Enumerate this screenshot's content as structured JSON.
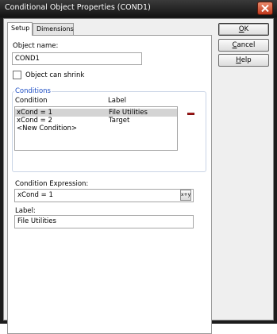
{
  "window": {
    "title": "Conditional Object Properties (COND1)"
  },
  "tabs": [
    {
      "label": "Setup",
      "active": true
    },
    {
      "label": "Dimensions",
      "active": false
    }
  ],
  "setup": {
    "object_name_label": "Object name:",
    "object_name_value": "COND1",
    "can_shrink_label": "Object can shrink",
    "can_shrink_checked": false,
    "conditions_caption": "Conditions",
    "col_condition": "Condition",
    "col_label": "Label",
    "conditions": [
      {
        "condition": "xCond = 1",
        "label": "File Utilities",
        "selected": true
      },
      {
        "condition": "xCond = 2",
        "label": "Target",
        "selected": false
      },
      {
        "condition": "<New Condition>",
        "label": "",
        "selected": false
      }
    ],
    "expression_label": "Condition Expression:",
    "expression_value": "xCond = 1",
    "expression_button": "x+y",
    "label_label": "Label:",
    "label_value": "File Utilities"
  },
  "buttons": {
    "ok_accel": "O",
    "ok_rest": "K",
    "cancel_accel": "C",
    "cancel_rest": "ancel",
    "help_accel": "H",
    "help_rest": "elp"
  },
  "colors": {
    "title_bar": "#1c1c1c",
    "close_button": "#c1381c",
    "group_caption": "#1f4fc4",
    "selection": "#d4d4d4",
    "remove_icon": "#c02020"
  }
}
